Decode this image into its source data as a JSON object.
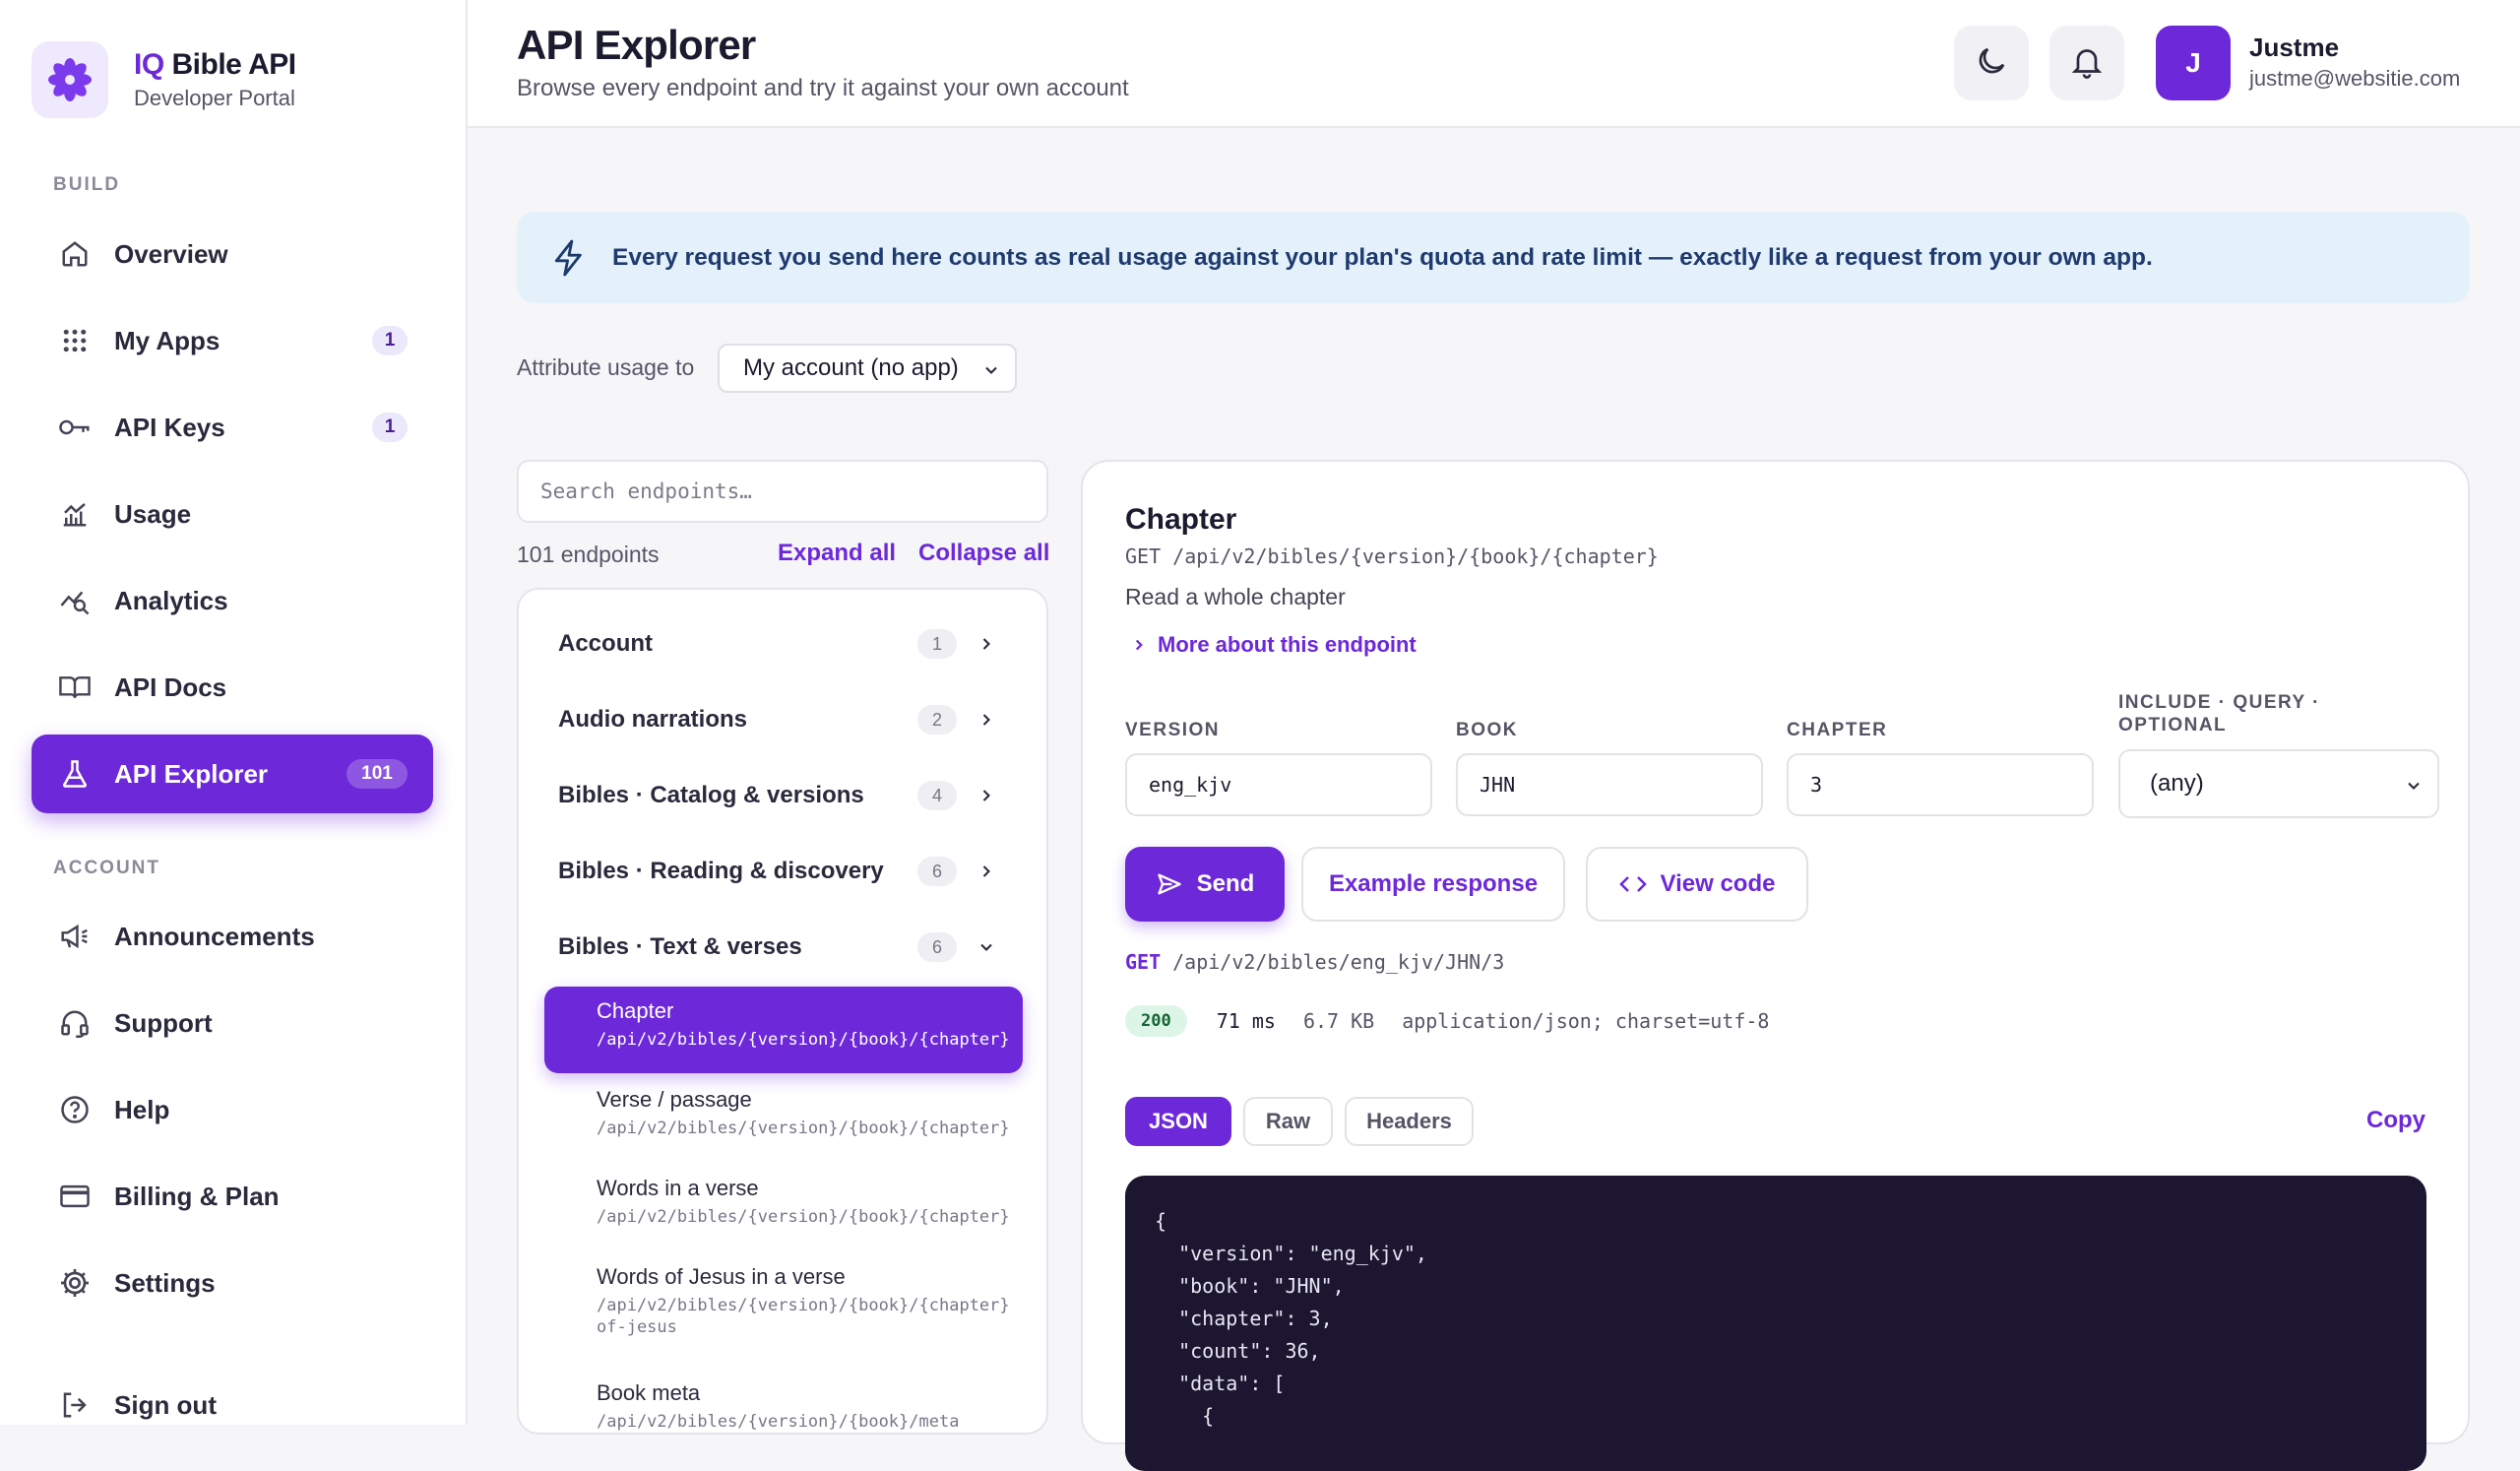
{
  "brand": {
    "title_prefix": "IQ",
    "title_rest": " Bible API",
    "subtitle": "Developer Portal"
  },
  "sidebar": {
    "build_label": "BUILD",
    "account_label": "ACCOUNT",
    "items": [
      {
        "label": "Overview",
        "icon": "home-icon"
      },
      {
        "label": "My Apps",
        "icon": "grid-icon",
        "badge": "1"
      },
      {
        "label": "API Keys",
        "icon": "key-icon",
        "badge": "1"
      },
      {
        "label": "Usage",
        "icon": "chart-icon"
      },
      {
        "label": "Analytics",
        "icon": "analytics-icon"
      },
      {
        "label": "API Docs",
        "icon": "book-icon"
      },
      {
        "label": "API Explorer",
        "icon": "flask-icon",
        "badge": "101",
        "active": true
      },
      {
        "label": "Announcements",
        "icon": "megaphone-icon"
      },
      {
        "label": "Support",
        "icon": "headset-icon"
      },
      {
        "label": "Help",
        "icon": "help-icon"
      },
      {
        "label": "Billing & Plan",
        "icon": "card-icon"
      },
      {
        "label": "Settings",
        "icon": "gear-icon"
      },
      {
        "label": "Sign out",
        "icon": "logout-icon"
      }
    ]
  },
  "header": {
    "title": "API Explorer",
    "subtitle": "Browse every endpoint and try it against your own account",
    "user_initial": "J",
    "user_name": "Justme",
    "user_email": "justme@websitie.com"
  },
  "banner": {
    "text": "Every request you send here counts as real usage against your plan's quota and rate limit — exactly like a request from your own app."
  },
  "attribution": {
    "label": "Attribute usage to",
    "selected": "My account (no app)"
  },
  "endpoints": {
    "search_placeholder": "Search endpoints…",
    "count": "101 endpoints",
    "expand_all": "Expand all",
    "collapse_all": "Collapse all",
    "groups": [
      {
        "name": "Account",
        "count": "1"
      },
      {
        "name": "Audio narrations",
        "count": "2"
      },
      {
        "name": "Bibles · Catalog & versions",
        "count": "4"
      },
      {
        "name": "Bibles · Reading & discovery",
        "count": "6"
      },
      {
        "name": "Bibles · Text & verses",
        "count": "6"
      }
    ],
    "items": [
      {
        "name": "Chapter",
        "path": "/api/v2/bibles/{version}/{book}/{chapter}"
      },
      {
        "name": "Verse / passage",
        "path": "/api/v2/bibles/{version}/{book}/{chapter}"
      },
      {
        "name": "Words in a verse",
        "path": "/api/v2/bibles/{version}/{book}/{chapter}"
      },
      {
        "name": "Words of Jesus in a verse",
        "path": "/api/v2/bibles/{version}/{book}/{chapter}",
        "path2": "of-jesus"
      },
      {
        "name": "Book meta",
        "path": "/api/v2/bibles/{version}/{book}/meta"
      }
    ]
  },
  "detail": {
    "title": "Chapter",
    "method_path": "GET /api/v2/bibles/{version}/{book}/{chapter}",
    "description": "Read a whole chapter",
    "more": "More about this endpoint",
    "fields": {
      "version_label": "VERSION",
      "version_value": "eng_kjv",
      "book_label": "BOOK",
      "book_value": "JHN",
      "chapter_label": "CHAPTER",
      "chapter_value": "3",
      "include_label_1": "INCLUDE · QUERY ·",
      "include_label_2": "OPTIONAL",
      "include_value": "(any)"
    },
    "buttons": {
      "send": "Send",
      "example": "Example response",
      "view_code": "View code"
    },
    "request": {
      "method": "GET",
      "path": "/api/v2/bibles/eng_kjv/JHN/3"
    },
    "response": {
      "status": "200",
      "time": "71 ms",
      "size": "6.7 KB",
      "content_type": "application/json; charset=utf-8"
    },
    "tabs": {
      "json": "JSON",
      "raw": "Raw",
      "headers": "Headers",
      "copy": "Copy"
    },
    "code": "{\n  \"version\": \"eng_kjv\",\n  \"book\": \"JHN\",\n  \"chapter\": 3,\n  \"count\": 36,\n  \"data\": [\n    {"
  },
  "colors": {
    "accent": "#6d28d9",
    "banner_bg": "#e4f1fb",
    "code_bg": "#1c1630"
  }
}
